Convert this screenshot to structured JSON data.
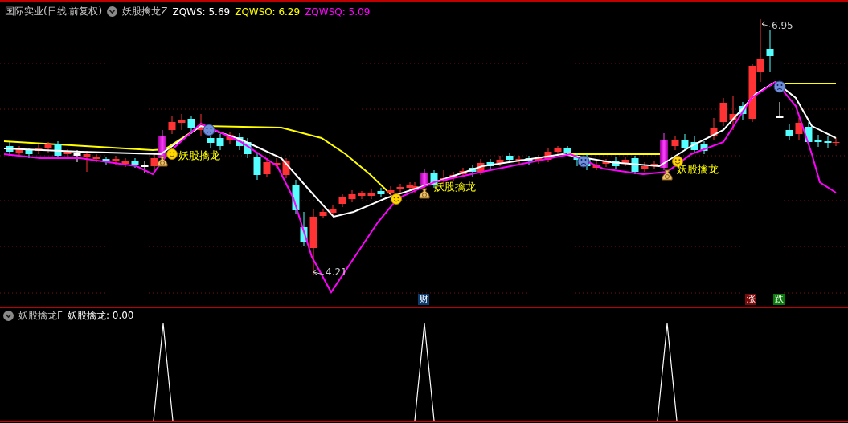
{
  "header": {
    "security": "国际实业(日线.前复权)",
    "indicator": "妖股擒龙Z",
    "readouts": [
      {
        "text": "ZQWS: 5.69",
        "color": "#ffffff"
      },
      {
        "text": "ZQWSO: 6.29",
        "color": "#ffff00"
      },
      {
        "text": "ZQWSQ: 5.09",
        "color": "#ff00ff"
      }
    ]
  },
  "price_labels": [
    {
      "text": "6.95",
      "kind": "high"
    },
    {
      "text": "4.21",
      "kind": "low"
    }
  ],
  "signals": [
    {
      "label": "妖股擒龙"
    },
    {
      "label": "妖股擒龙"
    },
    {
      "label": "妖股擒龙"
    }
  ],
  "events": [
    {
      "text": "财",
      "color": "#0d3b6e"
    },
    {
      "text": "涨",
      "color": "#7a0a0a"
    },
    {
      "text": "跌",
      "color": "#0a7a0a"
    }
  ],
  "sub_panel": {
    "indicator": "妖股擒龙F",
    "readout": "妖股擒龙: 0.00"
  }
}
